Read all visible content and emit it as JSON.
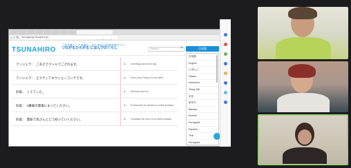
{
  "browser": {
    "active_tab": "TSUNAHIRO - つながるひろがる",
    "url": "tsunagarujp.tsunahiro.jp/..."
  },
  "site": {
    "logo": "TSUNAHIRO",
    "tagline_line1": "「生活者として外国人」のための日本語学習サイト",
    "tagline_line2": "つながるひろがる にほんでのくらし",
    "search_placeholder": "Search...",
    "language_button": "日本語"
  },
  "rows": [
    {
      "jp": "アンジェラ：　ごあさでクトルでござれます。",
      "num": "A：",
      "en": "Greetings about the day"
    },
    {
      "jp": "アンジェラ：　ビクティアネクションコンテです。",
      "num": "A：",
      "en": "Kono yuko Prime a Kono desu"
    },
    {
      "jp": "鈴森：　くえてした。",
      "num": "A：",
      "en": "Mehmet kono ko"
    },
    {
      "jp": "鈴森：　3番線の電車にまってください。",
      "num": "A：",
      "en": "El kimonote ke densen ni nothe kudasai"
    },
    {
      "jp": "鈴森：　着駅で鳥さんとどう知っていください。",
      "num": "A：",
      "en": "Ohuwabe de Kono ni ko tanta kudasai"
    }
  ],
  "languages": [
    "日本語",
    "English",
    "にほんご",
    "Filipino",
    "Indonesia",
    "Tiếng Việt",
    "中文",
    "한국어",
    "Bahasa",
    "Monnie ...",
    "Português",
    "Español",
    "Thai",
    "Português"
  ],
  "colors": {
    "brand": "#1aa3d9",
    "button": "#1a8fd6",
    "tile_active_border": "#9fd07a"
  }
}
